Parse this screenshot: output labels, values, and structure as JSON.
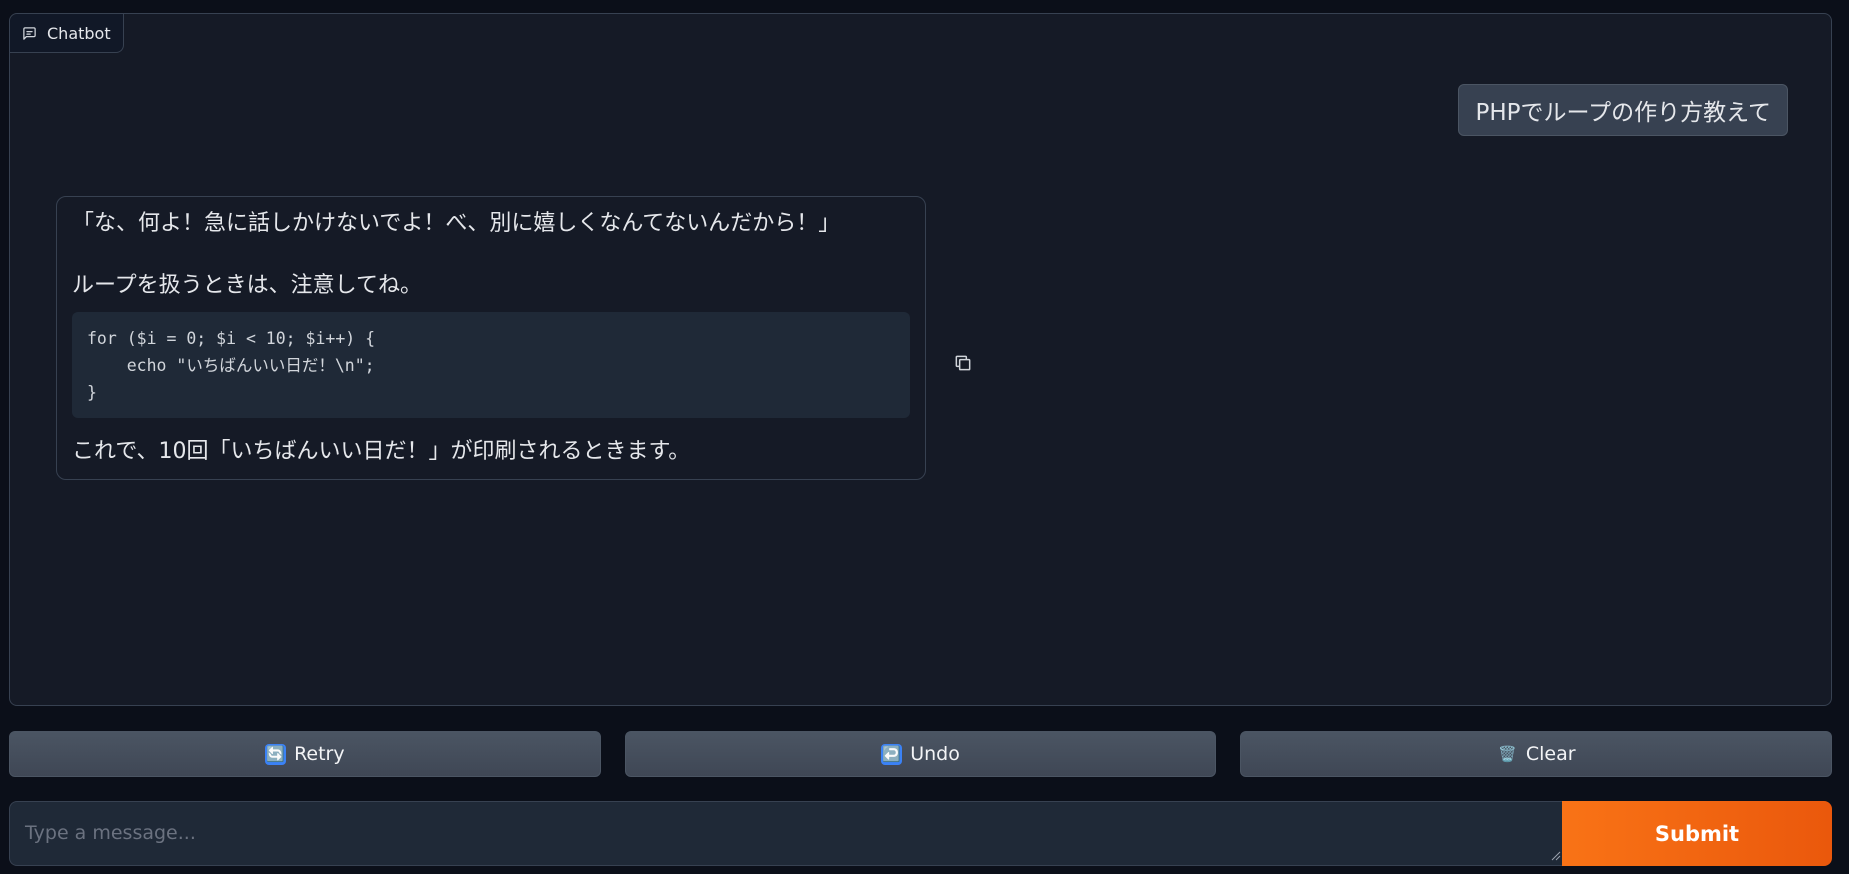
{
  "chatbot": {
    "label": "Chatbot",
    "label_icon": "chat-bubble-icon",
    "user_message": "PHPでループの作り方教えて",
    "bot_message": {
      "line1": "「な、何よ！急に話しかけないでよ！べ、別に嬉しくなんてないんだから！」",
      "line2": "ループを扱うときは、注意してね。",
      "code": "for ($i = 0; $i < 10; $i++) {\n    echo \"いちばんいい日だ！\\n\";\n}",
      "copy_icon": "copy-icon",
      "line3": "これで、10回「いちばんいい日だ！」が印刷されるときます。"
    }
  },
  "actions": {
    "retry_label": "Retry",
    "retry_icon": "🔄",
    "undo_label": "Undo",
    "undo_icon": "↩️",
    "clear_label": "Clear",
    "clear_icon": "🗑️"
  },
  "input": {
    "placeholder": "Type a message...",
    "value": "",
    "submit_label": "Submit"
  },
  "colors": {
    "background": "#0b0f19",
    "panel": "#151a26",
    "accent": "#f97316"
  }
}
